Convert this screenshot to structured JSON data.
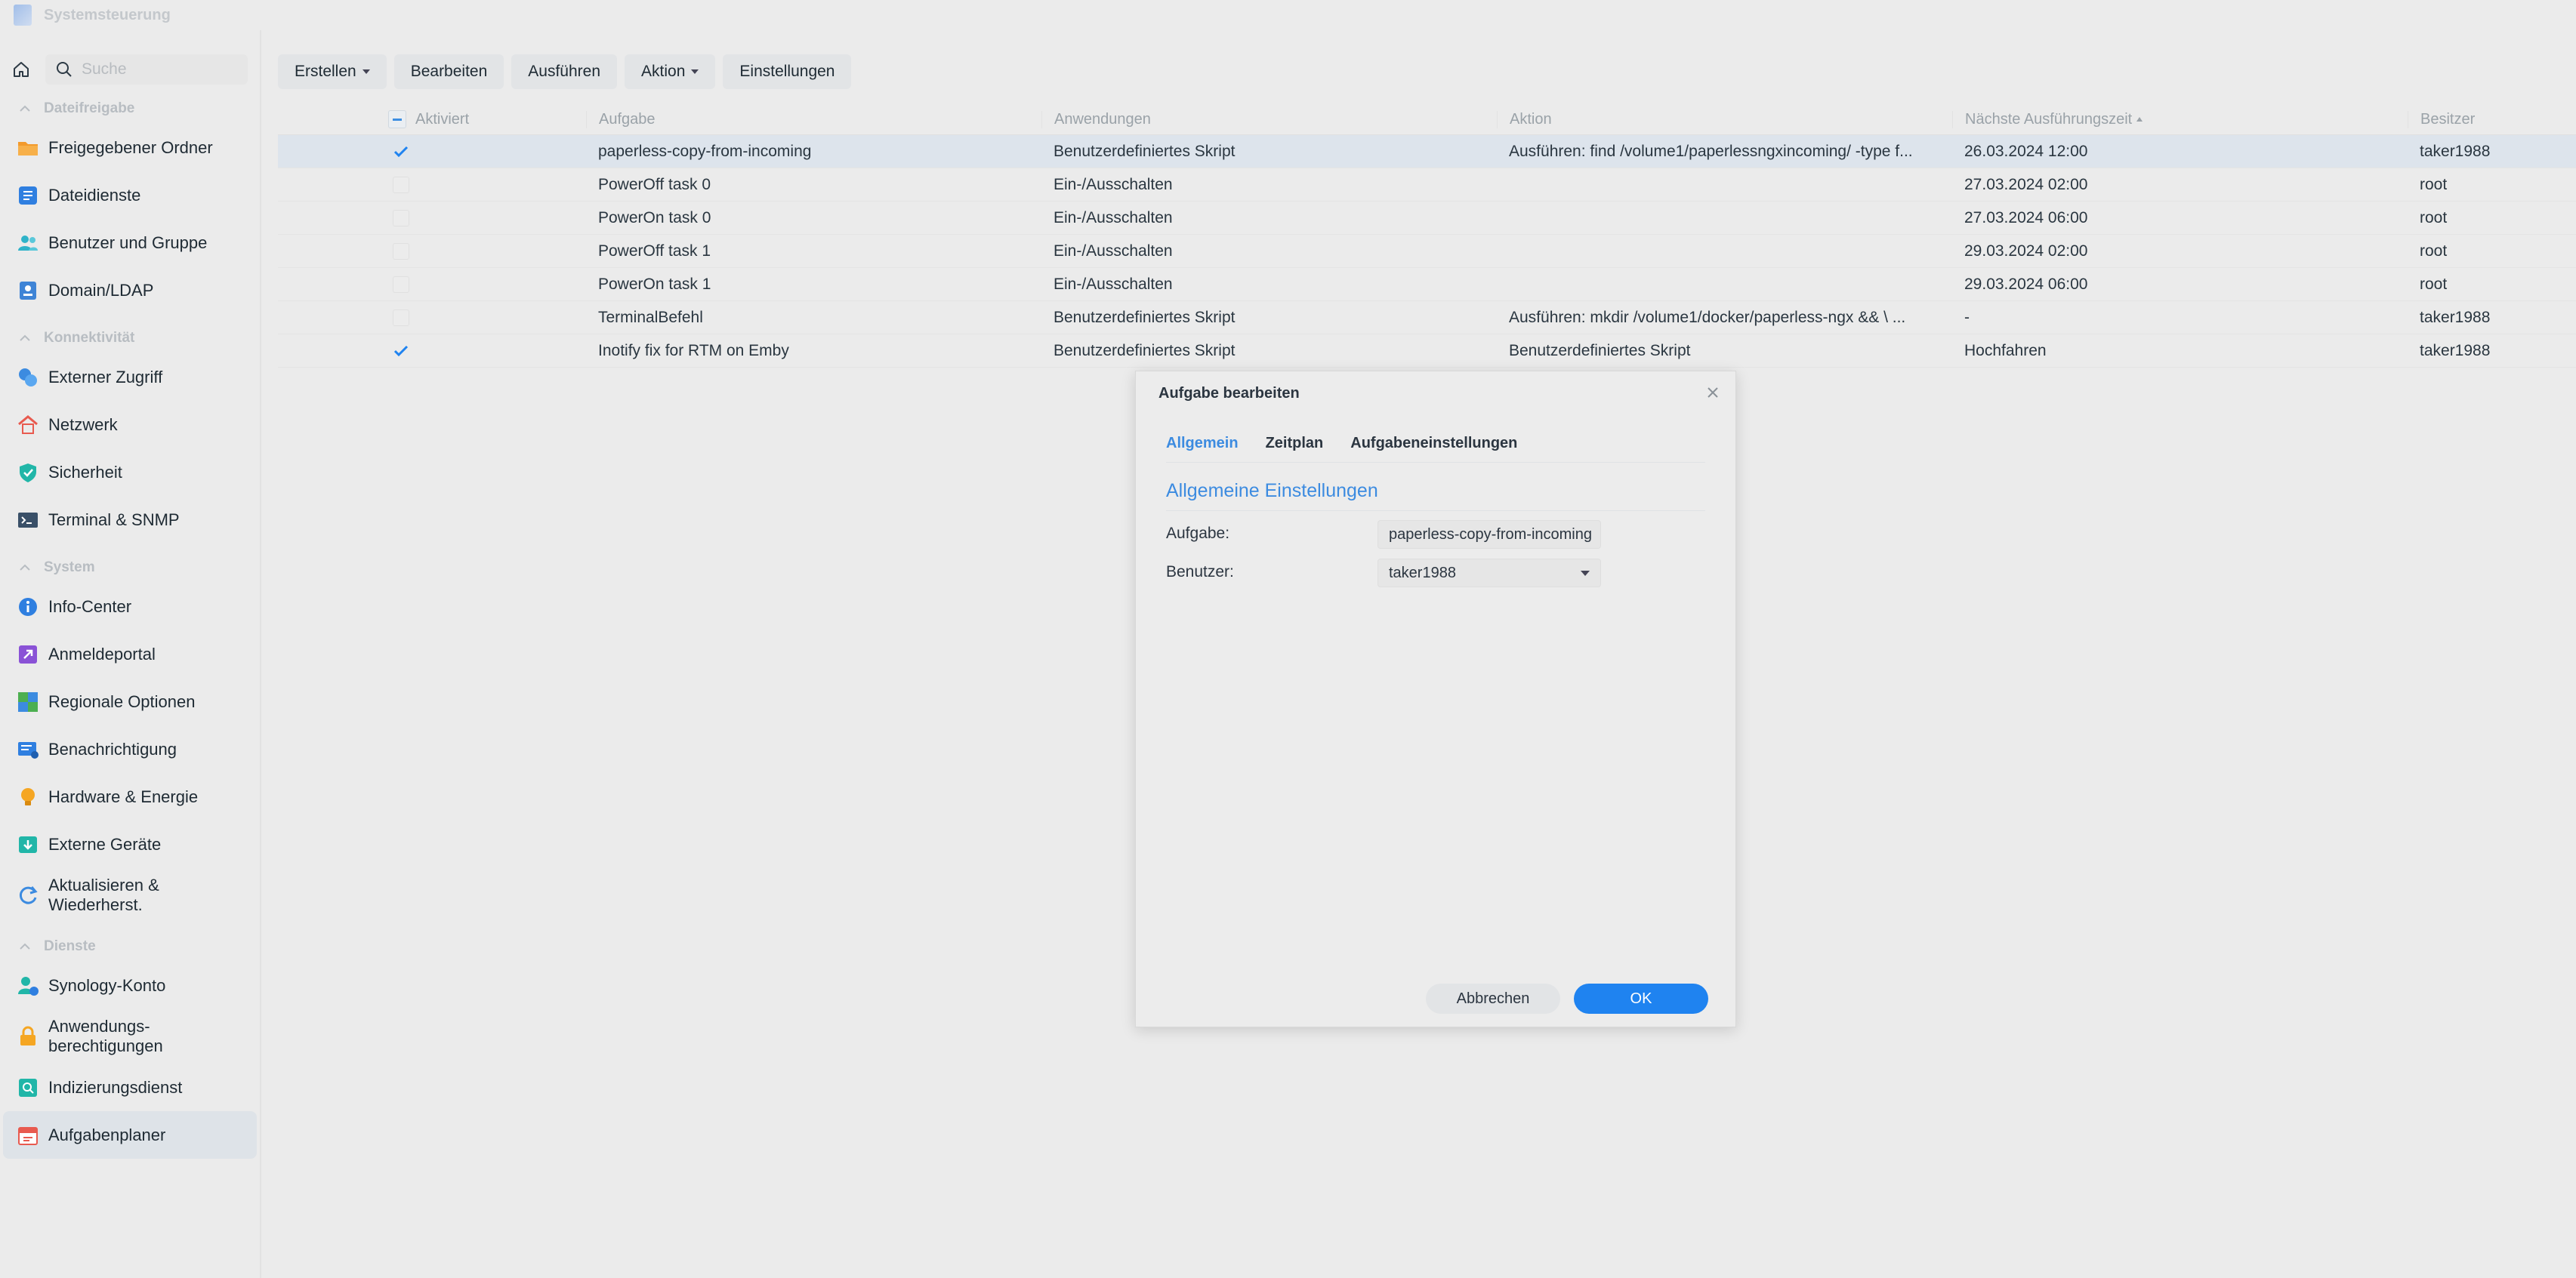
{
  "window": {
    "title": "Systemsteuerung",
    "icon": "control-panel-icon"
  },
  "sidebar": {
    "search_placeholder": "Suche",
    "sections": [
      {
        "header": "Dateifreigabe",
        "items": [
          {
            "label": "Freigegebener Ordner",
            "icon": "shared-folder-icon"
          },
          {
            "label": "Dateidienste",
            "icon": "file-services-icon"
          },
          {
            "label": "Benutzer und Gruppe",
            "icon": "users-icon"
          },
          {
            "label": "Domain/LDAP",
            "icon": "domain-icon"
          }
        ]
      },
      {
        "header": "Konnektivität",
        "items": [
          {
            "label": "Externer Zugriff",
            "icon": "external-access-icon"
          },
          {
            "label": "Netzwerk",
            "icon": "network-icon"
          },
          {
            "label": "Sicherheit",
            "icon": "security-shield-icon"
          },
          {
            "label": "Terminal & SNMP",
            "icon": "terminal-icon"
          }
        ]
      },
      {
        "header": "System",
        "items": [
          {
            "label": "Info-Center",
            "icon": "info-icon"
          },
          {
            "label": "Anmeldeportal",
            "icon": "login-portal-icon"
          },
          {
            "label": "Regionale Optionen",
            "icon": "regional-options-icon"
          },
          {
            "label": "Benachrichtigung",
            "icon": "notification-icon"
          },
          {
            "label": "Hardware & Energie",
            "icon": "hardware-energy-icon"
          },
          {
            "label": "Externe Geräte",
            "icon": "external-devices-icon"
          },
          {
            "label": "Aktualisieren & Wiederherst.",
            "line1": "Aktualisieren &",
            "line2": "Wiederherst.",
            "icon": "update-restore-icon"
          }
        ]
      },
      {
        "header": "Dienste",
        "items": [
          {
            "label": "Synology-Konto",
            "icon": "synology-account-icon"
          },
          {
            "label": "Anwendungsberechtigungen",
            "line1": "Anwendungs-",
            "line2": "berechtigungen",
            "icon": "app-privileges-icon"
          },
          {
            "label": "Indizierungsdienst",
            "icon": "indexing-icon"
          },
          {
            "label": "Aufgabenplaner",
            "icon": "task-scheduler-icon",
            "active": true
          }
        ]
      }
    ]
  },
  "toolbar": {
    "create": "Erstellen",
    "edit": "Bearbeiten",
    "run": "Ausführen",
    "action": "Aktion",
    "settings": "Einstellungen"
  },
  "table": {
    "columns": {
      "enabled": "Aktiviert",
      "task": "Aufgabe",
      "applications": "Anwendungen",
      "action": "Aktion",
      "next_run": "Nächste Ausführungszeit",
      "owner": "Besitzer"
    },
    "rows": [
      {
        "enabled": true,
        "task": "paperless-copy-from-incoming",
        "app": "Benutzerdefiniertes Skript",
        "action": "Ausführen: find /volume1/paperlessngxincoming/ -type f...",
        "next": "26.03.2024 12:00",
        "owner": "taker1988",
        "selected": true
      },
      {
        "enabled": false,
        "task": "PowerOff task 0",
        "app": "Ein-/Ausschalten",
        "action": "",
        "next": "27.03.2024 02:00",
        "owner": "root"
      },
      {
        "enabled": false,
        "task": "PowerOn task 0",
        "app": "Ein-/Ausschalten",
        "action": "",
        "next": "27.03.2024 06:00",
        "owner": "root"
      },
      {
        "enabled": false,
        "task": "PowerOff task 1",
        "app": "Ein-/Ausschalten",
        "action": "",
        "next": "29.03.2024 02:00",
        "owner": "root"
      },
      {
        "enabled": false,
        "task": "PowerOn task 1",
        "app": "Ein-/Ausschalten",
        "action": "",
        "next": "29.03.2024 06:00",
        "owner": "root"
      },
      {
        "enabled": false,
        "task": "TerminalBefehl",
        "app": "Benutzerdefiniertes Skript",
        "action": "Ausführen: mkdir /volume1/docker/paperless-ngx && \\ ...",
        "next": "-",
        "owner": "taker1988"
      },
      {
        "enabled": true,
        "task": "Inotify fix for RTM on Emby",
        "app": "Benutzerdefiniertes Skript",
        "action": "Benutzerdefiniertes Skript",
        "next": "Hochfahren",
        "owner": "taker1988"
      }
    ]
  },
  "dialog": {
    "title": "Aufgabe bearbeiten",
    "tabs": [
      "Allgemein",
      "Zeitplan",
      "Aufgabeneinstellungen"
    ],
    "active_tab": "Allgemein",
    "section_title": "Allgemeine Einstellungen",
    "task_label": "Aufgabe:",
    "task_value": "paperless-copy-from-incoming",
    "user_label": "Benutzer:",
    "user_value": "taker1988",
    "cancel": "Abbrechen",
    "ok": "OK"
  },
  "colors": {
    "accent": "#1f83f0",
    "link": "#3c8be0",
    "selected_row": "#dde4ec"
  }
}
